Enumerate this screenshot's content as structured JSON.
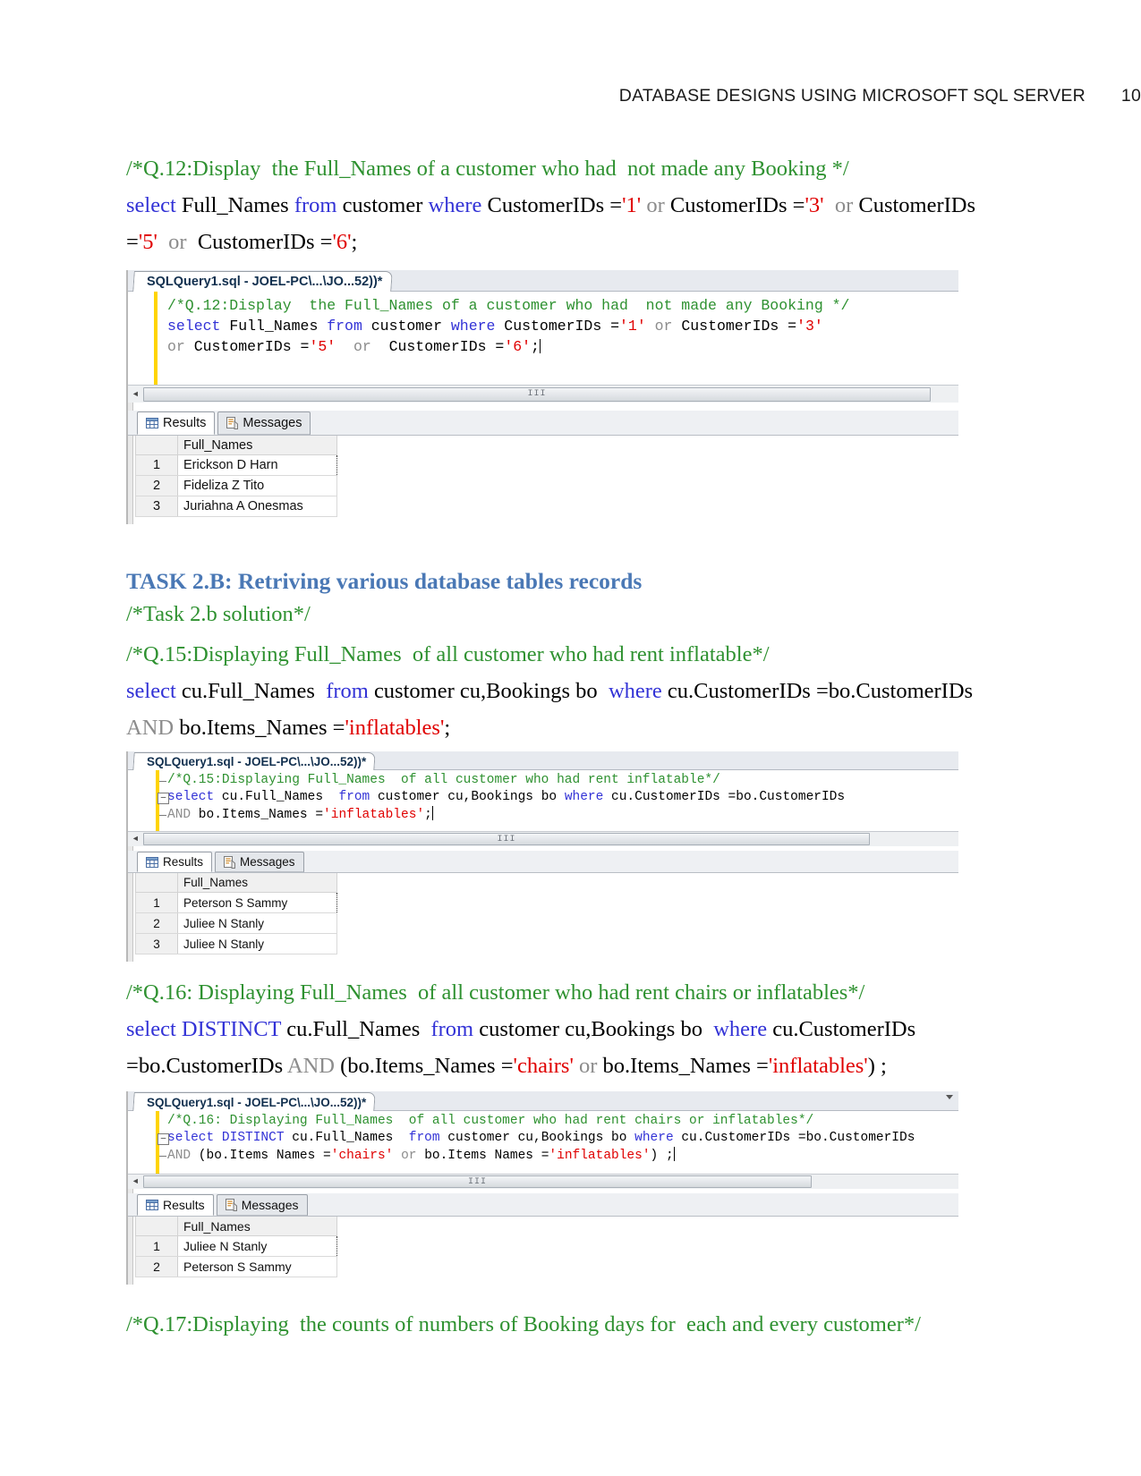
{
  "header": {
    "title": "DATABASE DESIGNS USING MICROSOFT SQL SERVER",
    "page_number": "10"
  },
  "colors": {
    "comment_green": "#2e9130",
    "keyword_blue": "#3232d6",
    "string_red": "#e00000",
    "operator_grey": "#8c8c8c",
    "heading_blue": "#4a78b5",
    "editor_gutter_yellow": "#ffd400"
  },
  "q12": {
    "comment": "/*Q.12:Display  the Full_Names of a customer who had  not made any Booking */",
    "sql_line1_a": "select",
    "sql_line1_b": " Full_Names ",
    "sql_line1_c": "from",
    "sql_line1_d": " customer ",
    "sql_line1_e": "where",
    "sql_line1_f": " CustomerIDs =",
    "sql_line1_g": "'1'",
    "sql_line1_h": " or ",
    "sql_line1_i": "CustomerIDs =",
    "sql_line1_j": "'3'",
    "sql_line1_k": "  or ",
    "sql_line1_l": "CustomerIDs",
    "sql_line2_a": "=",
    "sql_line2_b": "'5'",
    "sql_line2_c": "  or ",
    "sql_line2_d": " CustomerIDs =",
    "sql_line2_e": "'6'",
    "sql_line2_f": ";"
  },
  "task2b": {
    "heading": "TASK 2.B: Retriving various database tables records",
    "solution_comment": "/*Task 2.b solution*/"
  },
  "q15": {
    "comment": "/*Q.15:Displaying Full_Names  of all customer who had rent inflatable*/",
    "sql_l1_select": "select",
    "sql_l1_cols": " cu.Full_Names  ",
    "sql_l1_from": "from",
    "sql_l1_tables": " customer cu,Bookings bo  ",
    "sql_l1_where": "where",
    "sql_l1_cond": " cu.CustomerIDs =bo.CustomerIDs",
    "sql_l2_and": "AND",
    "sql_l2_mid": " bo.Items_Names =",
    "sql_l2_str": "'inflatables'",
    "sql_l2_end": ";"
  },
  "q16": {
    "comment": "/*Q.16: Displaying Full_Names  of all customer who had rent chairs or inflatables*/",
    "sql_l1_select": "select",
    "sql_l1_distinct": " DISTINCT",
    "sql_l1_cols": " cu.Full_Names  ",
    "sql_l1_from": "from",
    "sql_l1_tables": " customer cu,Bookings bo  ",
    "sql_l1_where": "where",
    "sql_l1_cond": " cu.CustomerIDs",
    "sql_l2_a": "=bo.CustomerIDs ",
    "sql_l2_and": "AND",
    "sql_l2_b": " (bo.Items_Names =",
    "sql_l2_s1": "'chairs'",
    "sql_l2_or": " or ",
    "sql_l2_c": "bo.Items_Names =",
    "sql_l2_s2": "'inflatables'",
    "sql_l2_d": ") ;"
  },
  "q17": {
    "comment": "/*Q.17:Displaying  the counts of numbers of Booking days for  each and every customer*/"
  },
  "ssms": {
    "tab_title": "SQLQuery1.sql - JOEL-PC\\...\\JO...52))*",
    "results_tab": "Results",
    "messages_tab": "Messages",
    "grid_icon": "grid-icon",
    "messages_icon": "messages-icon",
    "scroll_left_arrow": "◄",
    "scroll_thumb_grip": "III",
    "column_header": "Full_Names"
  },
  "shot1": {
    "code": [
      {
        "indent": "fold-none",
        "parts": [
          {
            "t": "/*Q.12:Display  the Full_Names of a customer who had  not made any Booking */",
            "c": "cmt"
          }
        ]
      },
      {
        "indent": "fold-none",
        "parts": [
          {
            "t": "select",
            "c": "kw"
          },
          {
            "t": " Full_Names ",
            "c": "blk"
          },
          {
            "t": "from",
            "c": "kw"
          },
          {
            "t": " customer ",
            "c": "blk"
          },
          {
            "t": "where",
            "c": "kw"
          },
          {
            "t": " CustomerIDs =",
            "c": "blk"
          },
          {
            "t": "'1'",
            "c": "str"
          },
          {
            "t": " or ",
            "c": "gry"
          },
          {
            "t": "CustomerIDs =",
            "c": "blk"
          },
          {
            "t": "'3'",
            "c": "str"
          }
        ]
      },
      {
        "indent": "fold-none",
        "parts": [
          {
            "t": "or ",
            "c": "gry"
          },
          {
            "t": "CustomerIDs =",
            "c": "blk"
          },
          {
            "t": "'5'",
            "c": "str"
          },
          {
            "t": "  or  ",
            "c": "gry"
          },
          {
            "t": "CustomerIDs =",
            "c": "blk"
          },
          {
            "t": "'6'",
            "c": "str"
          },
          {
            "t": ";",
            "c": "blk"
          }
        ]
      }
    ],
    "rows": [
      {
        "n": "1",
        "name": "Erickson D Harn",
        "selected": true
      },
      {
        "n": "2",
        "name": "Fideliza Z Tito",
        "selected": false
      },
      {
        "n": "3",
        "name": "Juriahna A Onesmas",
        "selected": false
      }
    ]
  },
  "shot2": {
    "code": [
      {
        "indent": "dash",
        "parts": [
          {
            "t": "/*Q.15:Displaying Full_Names  of all customer who had rent inflatable*/",
            "c": "cmt"
          }
        ]
      },
      {
        "indent": "box",
        "parts": [
          {
            "t": "select",
            "c": "kw"
          },
          {
            "t": " cu.Full_Names  ",
            "c": "blk"
          },
          {
            "t": "from",
            "c": "kw"
          },
          {
            "t": " customer cu,Bookings bo ",
            "c": "blk"
          },
          {
            "t": "where",
            "c": "kw"
          },
          {
            "t": " cu.CustomerIDs =bo.CustomerIDs",
            "c": "blk"
          }
        ]
      },
      {
        "indent": "dash",
        "parts": [
          {
            "t": "AND",
            "c": "gry"
          },
          {
            "t": " bo.Items_Names =",
            "c": "blk"
          },
          {
            "t": "'inflatables'",
            "c": "str"
          },
          {
            "t": ";",
            "c": "blk"
          }
        ]
      }
    ],
    "rows": [
      {
        "n": "1",
        "name": "Peterson S Sammy",
        "selected": true
      },
      {
        "n": "2",
        "name": "Juliee N Stanly",
        "selected": false
      },
      {
        "n": "3",
        "name": "Juliee N Stanly",
        "selected": false
      }
    ]
  },
  "shot3": {
    "code": [
      {
        "indent": "fold-none",
        "parts": [
          {
            "t": "/*Q.16: Displaying Full_Names  of all customer who had rent chairs or inflatables*/",
            "c": "cmt"
          }
        ]
      },
      {
        "indent": "box",
        "parts": [
          {
            "t": "select",
            "c": "kw"
          },
          {
            "t": " DISTINCT",
            "c": "kw"
          },
          {
            "t": " cu.Full_Names  ",
            "c": "blk"
          },
          {
            "t": "from",
            "c": "kw"
          },
          {
            "t": " customer cu,Bookings bo ",
            "c": "blk"
          },
          {
            "t": "where",
            "c": "kw"
          },
          {
            "t": " cu.CustomerIDs =bo.CustomerIDs",
            "c": "blk"
          }
        ]
      },
      {
        "indent": "dash",
        "parts": [
          {
            "t": "AND",
            "c": "gry"
          },
          {
            "t": " (bo.Items Names =",
            "c": "blk"
          },
          {
            "t": "'chairs'",
            "c": "str"
          },
          {
            "t": " or ",
            "c": "gry"
          },
          {
            "t": "bo.Items Names =",
            "c": "blk"
          },
          {
            "t": "'inflatables'",
            "c": "str"
          },
          {
            "t": ") ;",
            "c": "blk"
          }
        ]
      }
    ],
    "rows": [
      {
        "n": "1",
        "name": "Juliee N Stanly",
        "selected": true
      },
      {
        "n": "2",
        "name": "Peterson S Sammy",
        "selected": false
      }
    ]
  }
}
